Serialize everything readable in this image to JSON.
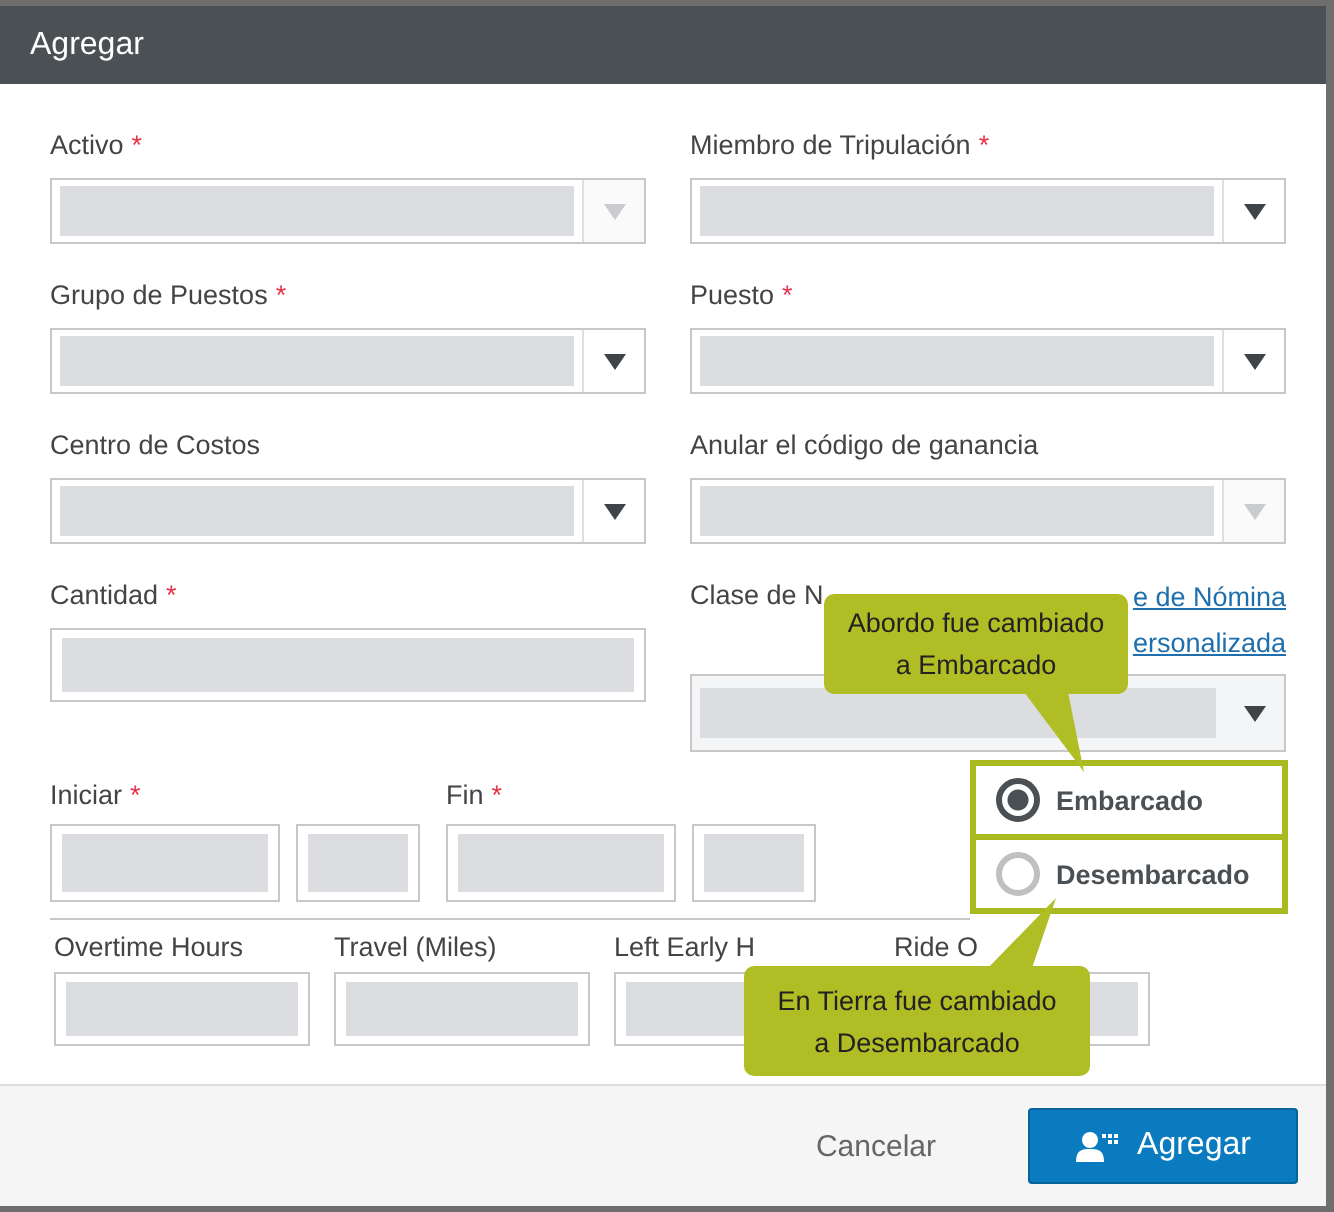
{
  "dialog": {
    "title": "Agregar"
  },
  "fields": [
    {
      "label": "Activo",
      "required_mark": "*",
      "kind": "select",
      "disabled": true
    },
    {
      "label": "Miembro de Tripulación",
      "required_mark": "*",
      "kind": "select",
      "disabled": false
    },
    {
      "label": "Grupo de Puestos",
      "required_mark": "*",
      "kind": "select",
      "disabled": false
    },
    {
      "label": "Puesto",
      "required_mark": "*",
      "kind": "select",
      "disabled": false
    },
    {
      "label": "Centro de Costos",
      "kind": "select",
      "disabled": false
    },
    {
      "label": "Anular el código de ganancia",
      "kind": "select",
      "disabled": true
    },
    {
      "label": "Cantidad",
      "required_mark": "*",
      "kind": "text"
    }
  ],
  "clase": {
    "label": "Clase de N",
    "link_lines": [
      "e de Nómina",
      "ersonalizada"
    ]
  },
  "time_fields": [
    {
      "label": "Iniciar",
      "required_mark": "*"
    },
    {
      "label": "Fin",
      "required_mark": "*"
    }
  ],
  "radio_options": [
    {
      "label": "Embarcado",
      "selected": true
    },
    {
      "label": "Desembarcado",
      "selected": false
    }
  ],
  "extra_fields": [
    {
      "label": "Overtime Hours"
    },
    {
      "label": "Travel (Miles)"
    },
    {
      "label": "Left Early H"
    },
    {
      "label": "Ride O"
    }
  ],
  "tooltips": [
    {
      "lines": [
        "Abordo fue cambiado",
        "a Embarcado"
      ]
    },
    {
      "lines": [
        "En Tierra fue cambiado",
        "a Desembarcado"
      ]
    }
  ],
  "buttons": {
    "cancel": "Cancelar",
    "add": "Agregar"
  }
}
